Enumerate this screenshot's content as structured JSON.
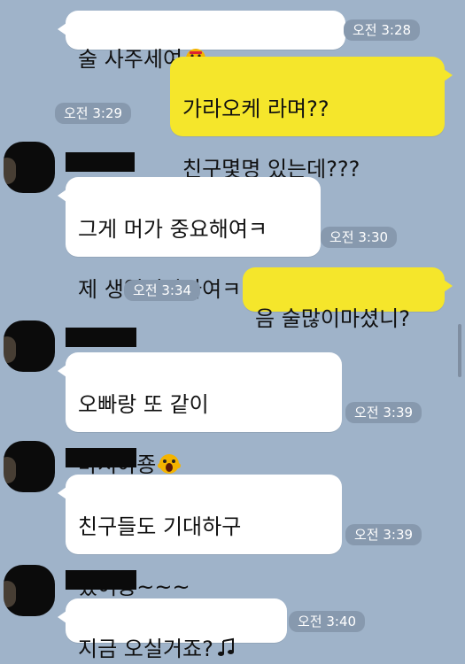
{
  "messages": [
    {
      "side": "them",
      "text": "술 사주세여",
      "emoji": "grinning-emoji",
      "time": "오전 3:28"
    },
    {
      "side": "me",
      "lines": [
        "가라오케 라며??",
        "친구몇명 있는데???"
      ],
      "time": "오전 3:29"
    },
    {
      "side": "them",
      "lines": [
        "그게 머가 중요해여ㅋ",
        "제 생일이자나여ㅋㅋ"
      ],
      "time": "오전 3:30"
    },
    {
      "side": "me",
      "text": "음 술많이마셨니?",
      "time": "오전 3:34"
    },
    {
      "side": "them",
      "lines": [
        "오빠랑 또 같이",
        "마셔야죵"
      ],
      "emoji": "screaming-emoji",
      "time": "오전 3:39"
    },
    {
      "side": "them",
      "lines": [
        "친구들도 기대하구",
        "있어용~~~"
      ],
      "time": "오전 3:39"
    },
    {
      "side": "them",
      "text": "지금 오실거죠?",
      "emoji": "music-note-icon",
      "time": "오전 3:40"
    }
  ],
  "colors": {
    "background": "#9fb3c9",
    "my_bubble": "#f5e62b",
    "their_bubble": "#ffffff"
  }
}
